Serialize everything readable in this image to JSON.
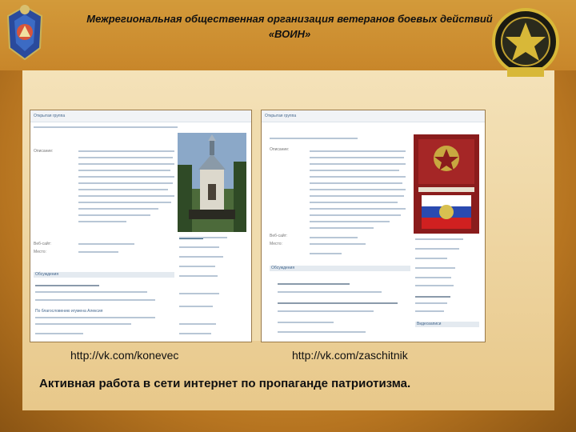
{
  "header": {
    "title_line1": "Межрегиональная общественная организация ветеранов боевых действий",
    "title_line2": "«ВОИН»"
  },
  "emblems": {
    "left_icon": "soldier-emblem-icon",
    "right_icon": "veterans-medal-icon"
  },
  "screenshots": [
    {
      "url": "http://vk.com/konevec",
      "page_label": "Открытая группа",
      "labels": [
        "Описание:",
        "Веб-сайт:",
        "Место:",
        "Обсуждения",
        "Записи группы",
        "По благословению игумена Алексия"
      ]
    },
    {
      "url": "http://vk.com/zaschitnik",
      "page_label": "Открытая группа",
      "labels": [
        "Описание:",
        "Веб-сайт:",
        "Место:",
        "Обсуждения",
        "Видеозаписи"
      ]
    }
  ],
  "caption": "Активная работа в сети интернет по  пропаганде патриотизма.",
  "colors": {
    "background": "#c4862c",
    "panel": "#f0d8a4",
    "vk_link": "#2b587a"
  }
}
